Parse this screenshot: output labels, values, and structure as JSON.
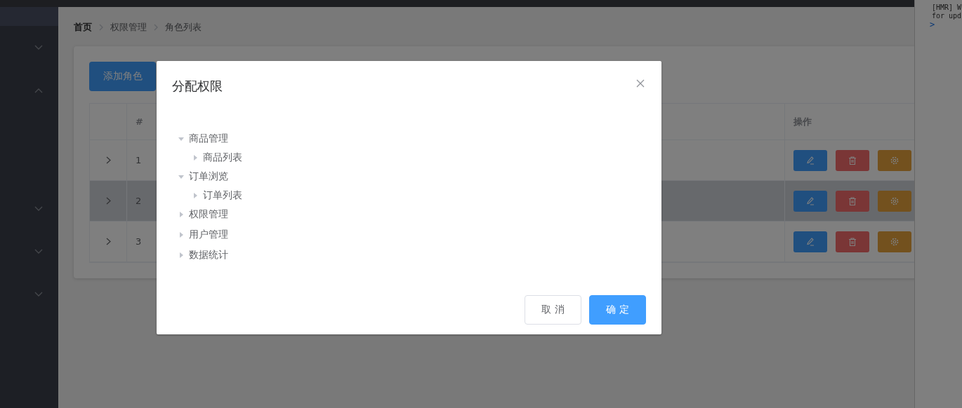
{
  "sidebar": {
    "menus": [
      {
        "expanded": false
      },
      {
        "expanded": true
      },
      {
        "expanded": false
      },
      {
        "expanded": false
      },
      {
        "expanded": false
      }
    ]
  },
  "breadcrumb": [
    {
      "label": "首页",
      "link": true
    },
    {
      "label": "权限管理",
      "link": false
    },
    {
      "label": "角色列表",
      "link": false
    }
  ],
  "add_button": "添加角色",
  "table": {
    "columns": [
      "#",
      "操作"
    ],
    "rows": [
      {
        "index": "1",
        "hovered": false
      },
      {
        "index": "2",
        "hovered": true
      },
      {
        "index": "3",
        "hovered": false
      }
    ]
  },
  "dialog": {
    "title": "分配权限",
    "tree": [
      {
        "label": "商品管理",
        "expanded": true,
        "children": [
          {
            "label": "商品列表",
            "expanded": false
          }
        ]
      },
      {
        "label": "订单浏览",
        "expanded": true,
        "children": [
          {
            "label": "订单列表",
            "expanded": false
          }
        ]
      },
      {
        "label": "权限管理",
        "expanded": false
      },
      {
        "label": "用户管理",
        "expanded": false
      },
      {
        "label": "数据统计",
        "expanded": false
      }
    ],
    "buttons": [
      {
        "label": "取 消",
        "kind": "default"
      },
      {
        "label": "确 定",
        "kind": "primary"
      }
    ]
  },
  "console": {
    "lines": [
      "[HMR] W",
      "for upd"
    ],
    "prompt": ">"
  }
}
